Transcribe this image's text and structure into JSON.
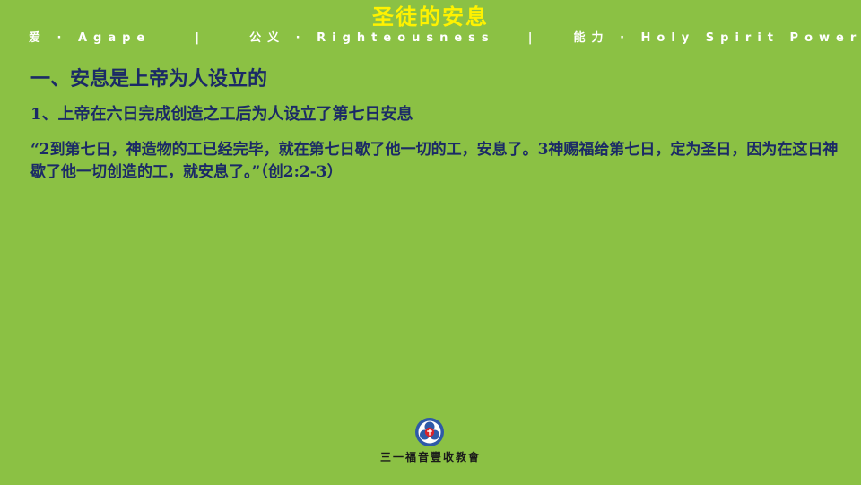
{
  "slide": {
    "title": "圣徒的安息",
    "motto": {
      "love": "爱 · Agape",
      "sep1": "|",
      "righteousness": "公义 · Righteousness",
      "sep2": "|",
      "power": "能力 · Holy Spirit Power"
    },
    "section_heading": "一、安息是上帝为人设立的",
    "subheading": "1、上帝在六日完成创造之工后为人设立了第七日安息",
    "scripture": "“2到第七日，神造物的工已经完毕，就在第七日歇了他一切的工，安息了。3神赐福给第七日，定为圣日，因为在这日神歇了他一切创造的工，就安息了。”（创2:2-3）",
    "footer": {
      "logo": "church-logo",
      "church_name": "三一福音豐收教會"
    }
  },
  "colors": {
    "background": "#8bc144",
    "title": "#fff200",
    "body_text": "#1b2a66",
    "motto": "#ffffff",
    "logo_blue": "#2e5aa8",
    "logo_red": "#d8232a"
  }
}
